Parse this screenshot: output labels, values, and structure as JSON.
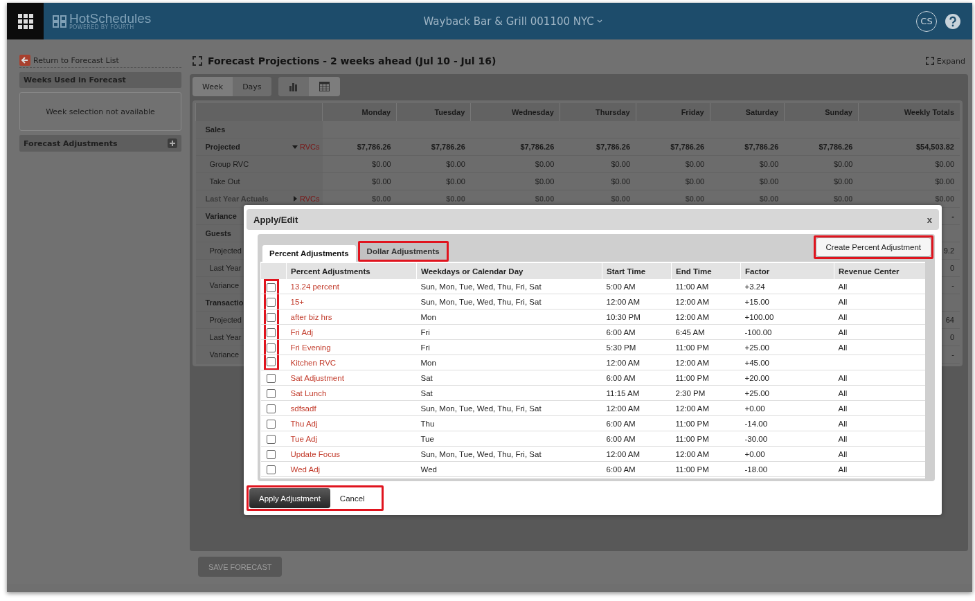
{
  "header": {
    "app_name": "HotSchedules",
    "app_tagline": "POWERED BY FOURTH",
    "location": "Wayback Bar & Grill 001100 NYC",
    "user_initials": "CS"
  },
  "sidebar": {
    "back_link": "Return to Forecast List",
    "weeks_title": "Weeks Used in Forecast",
    "weeks_message": "Week selection not available",
    "adjustments_title": "Forecast Adjustments"
  },
  "forecast": {
    "title": "Forecast Projections - 2 weeks ahead (Jul 10 - Jul 16)",
    "expand": "Expand",
    "view_tabs": [
      {
        "label": "Week",
        "selected": true
      },
      {
        "label": "Days",
        "selected": false
      }
    ],
    "display_tabs": [
      {
        "kind": "chart",
        "selected": false
      },
      {
        "kind": "table",
        "selected": true
      }
    ],
    "columns": [
      "Monday",
      "Tuesday",
      "Wednesday",
      "Thursday",
      "Friday",
      "Saturday",
      "Sunday",
      "Weekly Totals"
    ],
    "rows": [
      {
        "kind": "section",
        "label": "Sales"
      },
      {
        "kind": "total",
        "label": "Projected",
        "toggle": {
          "label": "RVCs",
          "expanded": true
        },
        "values": [
          "$7,786.26",
          "$7,786.26",
          "$7,786.26",
          "$7,786.26",
          "$7,786.26",
          "$7,786.26",
          "$7,786.26",
          "$54,503.82"
        ]
      },
      {
        "kind": "sub",
        "label": "Group RVC",
        "values": [
          "$0.00",
          "$0.00",
          "$0.00",
          "$0.00",
          "$0.00",
          "$0.00",
          "$0.00",
          "$0.00"
        ]
      },
      {
        "kind": "sub",
        "label": "Take Out",
        "values": [
          "$0.00",
          "$0.00",
          "$0.00",
          "$0.00",
          "$0.00",
          "$0.00",
          "$0.00",
          "$0.00"
        ]
      },
      {
        "kind": "muted",
        "label": "Last Year Actuals",
        "toggle": {
          "label": "RVCs",
          "expanded": false
        },
        "values": [
          "$0.00",
          "$0.00",
          "$0.00",
          "$0.00",
          "$0.00",
          "$0.00",
          "$0.00",
          "$0.00"
        ]
      },
      {
        "kind": "total",
        "label": "Variance",
        "tail": "-"
      },
      {
        "kind": "section",
        "label": "Guests"
      },
      {
        "kind": "sub",
        "label": "Projected",
        "tail": "9.2"
      },
      {
        "kind": "sub",
        "label": "Last Year",
        "tail": "0"
      },
      {
        "kind": "sub",
        "label": "Variance",
        "tail": "-"
      },
      {
        "kind": "section",
        "label": "Transactio"
      },
      {
        "kind": "sub",
        "label": "Projected",
        "tail": "64"
      },
      {
        "kind": "sub",
        "label": "Last Year",
        "tail": "0"
      },
      {
        "kind": "sub",
        "label": "Variance",
        "tail": "-"
      }
    ],
    "save_button": {
      "label": "SAVE FORECAST",
      "disabled": true
    }
  },
  "dialog": {
    "title": "Apply/Edit",
    "close": "x",
    "tabs": [
      {
        "label": "Percent Adjustments",
        "selected": true,
        "highlighted": false
      },
      {
        "label": "Dollar Adjustments",
        "selected": false,
        "highlighted": true
      }
    ],
    "create_button": {
      "label": "Create Percent Adjustment",
      "highlighted": true
    },
    "columns": [
      "Percent Adjustments",
      "Weekdays or Calendar Day",
      "Start Time",
      "End Time",
      "Factor",
      "Revenue Center"
    ],
    "rows": [
      {
        "name": "13.24 percent",
        "days": "Sun, Mon, Tue, Wed, Thu, Fri, Sat",
        "start": "5:00 AM",
        "end": "11:00 AM",
        "factor": "+3.24",
        "revenue": "All",
        "checked": false,
        "highlighted": true
      },
      {
        "name": "15+",
        "days": "Sun, Mon, Tue, Wed, Thu, Fri, Sat",
        "start": "12:00 AM",
        "end": "12:00 AM",
        "factor": "+15.00",
        "revenue": "All",
        "checked": false,
        "highlighted": true
      },
      {
        "name": "after biz hrs",
        "days": "Mon",
        "start": "10:30 PM",
        "end": "12:00 AM",
        "factor": "+100.00",
        "revenue": "All",
        "checked": false,
        "highlighted": true
      },
      {
        "name": "Fri Adj",
        "days": "Fri",
        "start": "6:00 AM",
        "end": "6:45 AM",
        "factor": "-100.00",
        "revenue": "All",
        "checked": false,
        "highlighted": true
      },
      {
        "name": "Fri Evening",
        "days": "Fri",
        "start": "5:30 PM",
        "end": "11:00 PM",
        "factor": "+25.00",
        "revenue": "All",
        "checked": false,
        "highlighted": true
      },
      {
        "name": "Kitchen RVC",
        "days": "Mon",
        "start": "12:00 AM",
        "end": "12:00 AM",
        "factor": "+45.00",
        "checked": false,
        "highlighted": true
      },
      {
        "name": "Sat Adjustment",
        "days": "Sat",
        "start": "6:00 AM",
        "end": "11:00 PM",
        "factor": "+20.00",
        "revenue": "All",
        "checked": false,
        "highlighted": false
      },
      {
        "name": "Sat Lunch",
        "days": "Sat",
        "start": "11:15 AM",
        "end": "2:30 PM",
        "factor": "+25.00",
        "revenue": "All",
        "checked": false,
        "highlighted": false
      },
      {
        "name": "sdfsadf",
        "days": "Sun, Mon, Tue, Wed, Thu, Fri, Sat",
        "start": "12:00 AM",
        "end": "12:00 AM",
        "factor": "+0.00",
        "revenue": "All",
        "checked": false,
        "highlighted": false
      },
      {
        "name": "Thu Adj",
        "days": "Thu",
        "start": "6:00 AM",
        "end": "11:00 PM",
        "factor": "-14.00",
        "revenue": "All",
        "checked": false,
        "highlighted": false
      },
      {
        "name": "Tue Adj",
        "days": "Tue",
        "start": "6:00 AM",
        "end": "11:00 PM",
        "factor": "-30.00",
        "revenue": "All",
        "checked": false,
        "highlighted": false
      },
      {
        "name": "Update Focus",
        "days": "Sun, Mon, Tue, Wed, Thu, Fri, Sat",
        "start": "12:00 AM",
        "end": "12:00 AM",
        "factor": "+0.00",
        "revenue": "All",
        "checked": false,
        "highlighted": false
      },
      {
        "name": "Wed Adj",
        "days": "Wed",
        "start": "6:00 AM",
        "end": "11:00 PM",
        "factor": "-18.00",
        "revenue": "All",
        "checked": false,
        "highlighted": false
      }
    ],
    "footer_highlighted": true,
    "apply_button": "Apply Adjustment",
    "cancel": "Cancel"
  }
}
